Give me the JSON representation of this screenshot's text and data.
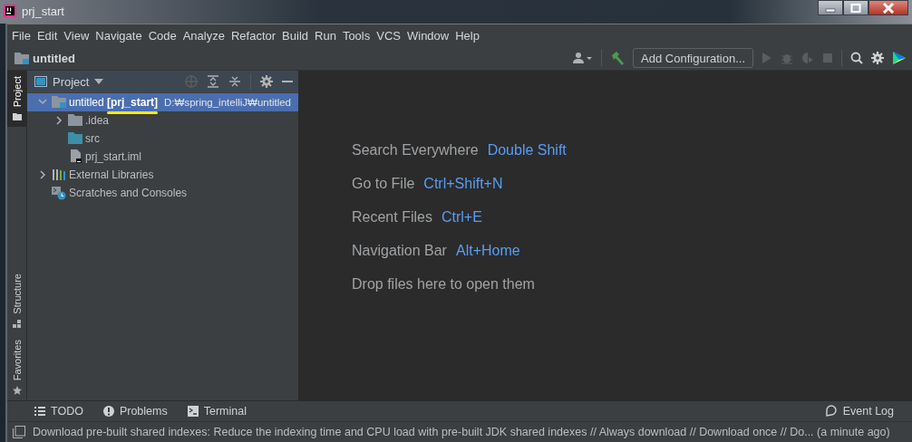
{
  "window": {
    "title": "prj_start"
  },
  "menu": [
    "File",
    "Edit",
    "View",
    "Navigate",
    "Code",
    "Analyze",
    "Refactor",
    "Build",
    "Run",
    "Tools",
    "VCS",
    "Window",
    "Help"
  ],
  "navigation_bar": {
    "project": "untitled",
    "run_configuration": "Add Configuration..."
  },
  "side_tabs": {
    "top": [
      {
        "kind": "project",
        "label": "Project",
        "selected": true
      }
    ],
    "bottom": [
      {
        "kind": "structure",
        "label": "Structure",
        "selected": false
      },
      {
        "kind": "favorites",
        "label": "Favorites",
        "selected": false
      }
    ]
  },
  "project_panel": {
    "title": "Project",
    "tree": [
      {
        "kind": "module",
        "name": "untitled **[prj_start]**",
        "path": "D:₩spring_intelliJ₩untitled",
        "expanded": true,
        "selected": true,
        "children": [
          {
            "kind": "folder",
            "name": ".idea",
            "expanded": false,
            "selected": false
          },
          {
            "kind": "source",
            "name": "src",
            "selected": false
          },
          {
            "kind": "file",
            "name": "prj_start.iml",
            "selected": false
          }
        ]
      },
      {
        "kind": "library",
        "name": "External Libraries",
        "expanded": false,
        "selected": false
      },
      {
        "kind": "scratches",
        "name": "Scratches and Consoles",
        "selected": false
      }
    ]
  },
  "editor_hints": [
    {
      "label": "Search Everywhere",
      "shortcut": "Double Shift"
    },
    {
      "label": "Go to File",
      "shortcut": "Ctrl+Shift+N"
    },
    {
      "label": "Recent Files",
      "shortcut": "Ctrl+E"
    },
    {
      "label": "Navigation Bar",
      "shortcut": "Alt+Home"
    },
    {
      "label": "Drop files here to open them"
    }
  ],
  "tool_windows": [
    {
      "kind": "todo",
      "label": "TODO"
    },
    {
      "kind": "problems",
      "label": "Problems"
    },
    {
      "kind": "terminal",
      "label": "Terminal"
    }
  ],
  "event_log": "Event Log",
  "status_bar": "Download pre-built shared indexes: Reduce the indexing time and CPU load with pre-built JDK shared indexes // Always download // Download once // Do... (a minute ago)"
}
